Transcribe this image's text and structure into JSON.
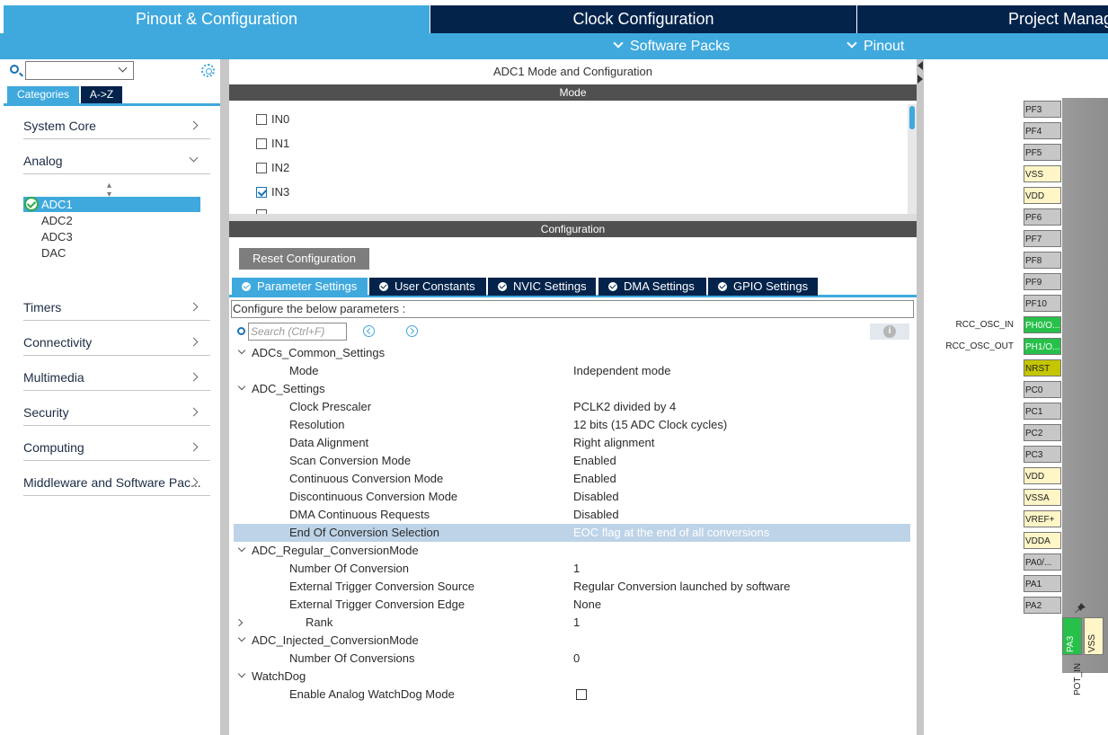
{
  "top_tabs": [
    {
      "label": "Pinout & Configuration"
    },
    {
      "label": "Clock Configuration"
    },
    {
      "label": "Project Manager"
    }
  ],
  "sub_menu": {
    "software_packs": "Software Packs",
    "pinout": "Pinout"
  },
  "left": {
    "tabs": {
      "categories": "Categories",
      "az": "A->Z"
    },
    "categories": [
      {
        "label": "System Core"
      },
      {
        "label": "Analog"
      },
      {
        "label": "Timers"
      },
      {
        "label": "Connectivity"
      },
      {
        "label": "Multimedia"
      },
      {
        "label": "Security"
      },
      {
        "label": "Computing"
      },
      {
        "label": "Middleware and Software Pac..."
      }
    ],
    "analog_items": [
      {
        "label": "ADC1",
        "selected": true
      },
      {
        "label": "ADC2"
      },
      {
        "label": "ADC3"
      },
      {
        "label": "DAC"
      }
    ]
  },
  "center": {
    "title": "ADC1 Mode and Configuration",
    "mode_header": "Mode",
    "mode_items": [
      {
        "label": "IN0",
        "checked": false
      },
      {
        "label": "IN1",
        "checked": false
      },
      {
        "label": "IN2",
        "checked": false
      },
      {
        "label": "IN3",
        "checked": true
      }
    ],
    "config_header": "Configuration",
    "reset_button": "Reset Configuration",
    "config_tabs": [
      {
        "label": "Parameter Settings",
        "active": true
      },
      {
        "label": "User Constants"
      },
      {
        "label": "NVIC Settings"
      },
      {
        "label": "DMA Settings"
      },
      {
        "label": "GPIO Settings"
      }
    ],
    "description": "Configure the below parameters :",
    "search_placeholder": "Search (Ctrl+F)",
    "info_glyph": "i",
    "params": [
      {
        "name": "ADCs_Common_Settings",
        "value": "",
        "level": 0,
        "expand": "open"
      },
      {
        "name": "Mode",
        "value": "Independent mode",
        "level": 1
      },
      {
        "name": "ADC_Settings",
        "value": "",
        "level": 0,
        "expand": "open"
      },
      {
        "name": "Clock Prescaler",
        "value": "PCLK2 divided by 4",
        "level": 1
      },
      {
        "name": "Resolution",
        "value": "12 bits (15 ADC Clock cycles)",
        "level": 1
      },
      {
        "name": "Data Alignment",
        "value": "Right alignment",
        "level": 1
      },
      {
        "name": "Scan Conversion Mode",
        "value": "Enabled",
        "level": 1
      },
      {
        "name": "Continuous Conversion Mode",
        "value": "Enabled",
        "level": 1
      },
      {
        "name": "Discontinuous Conversion Mode",
        "value": "Disabled",
        "level": 1
      },
      {
        "name": "DMA Continuous Requests",
        "value": "Disabled",
        "level": 1
      },
      {
        "name": "End Of Conversion Selection",
        "value": "EOC flag at the end of all conversions",
        "level": 1,
        "highlight": true
      },
      {
        "name": "ADC_Regular_ConversionMode",
        "value": "",
        "level": 0,
        "expand": "open"
      },
      {
        "name": "Number Of Conversion",
        "value": "1",
        "level": 1
      },
      {
        "name": "External Trigger Conversion Source",
        "value": "Regular Conversion launched by software",
        "level": 1
      },
      {
        "name": "External Trigger Conversion Edge",
        "value": "None",
        "level": 1
      },
      {
        "name": "Rank",
        "value": "1",
        "level": 2,
        "expand": "closed"
      },
      {
        "name": "ADC_Injected_ConversionMode",
        "value": "",
        "level": 0,
        "expand": "open"
      },
      {
        "name": "Number Of Conversions",
        "value": "0",
        "level": 1
      },
      {
        "name": "WatchDog",
        "value": "",
        "level": 0,
        "expand": "open"
      },
      {
        "name": "Enable Analog WatchDog Mode",
        "value": "",
        "level": 1,
        "checkbox": true
      }
    ]
  },
  "chip": {
    "pins": [
      {
        "label": "PF3",
        "kind": "gray"
      },
      {
        "label": "PF4",
        "kind": "gray"
      },
      {
        "label": "PF5",
        "kind": "gray"
      },
      {
        "label": "VSS",
        "kind": "power"
      },
      {
        "label": "VDD",
        "kind": "power"
      },
      {
        "label": "PF6",
        "kind": "gray"
      },
      {
        "label": "PF7",
        "kind": "gray"
      },
      {
        "label": "PF8",
        "kind": "gray"
      },
      {
        "label": "PF9",
        "kind": "gray"
      },
      {
        "label": "PF10",
        "kind": "gray"
      },
      {
        "label": "PH0/O...",
        "kind": "green",
        "signal": "RCC_OSC_IN"
      },
      {
        "label": "PH1/O...",
        "kind": "green",
        "signal": "RCC_OSC_OUT"
      },
      {
        "label": "NRST",
        "kind": "yellow"
      },
      {
        "label": "PC0",
        "kind": "gray"
      },
      {
        "label": "PC1",
        "kind": "gray"
      },
      {
        "label": "PC2",
        "kind": "gray"
      },
      {
        "label": "PC3",
        "kind": "gray"
      },
      {
        "label": "VDD",
        "kind": "power"
      },
      {
        "label": "VSSA",
        "kind": "power"
      },
      {
        "label": "VREF+",
        "kind": "power"
      },
      {
        "label": "VDDA",
        "kind": "power"
      },
      {
        "label": "PA0/...",
        "kind": "gray"
      },
      {
        "label": "PA1",
        "kind": "gray"
      },
      {
        "label": "PA2",
        "kind": "gray"
      }
    ],
    "bottom_pins": [
      {
        "label": "PA3",
        "kind": "green"
      },
      {
        "label": "VSS",
        "kind": "power"
      }
    ],
    "bottom_signal": "POT_IN"
  }
}
